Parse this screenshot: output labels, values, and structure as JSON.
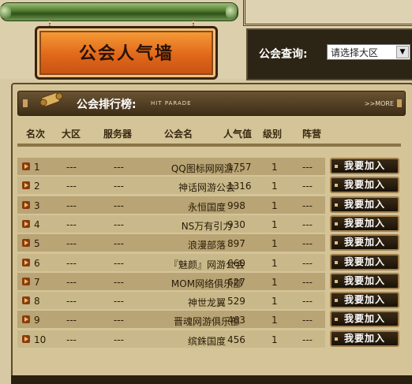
{
  "header": {
    "title": "公会人气墙",
    "search_label": "公会查询:",
    "region_select": "请选择大区"
  },
  "panel": {
    "title": "公会排行榜:",
    "subtitle": "HIT PARADE",
    "more": ">>MORE"
  },
  "columns": [
    "名次",
    "大区",
    "服务器",
    "公会名",
    "人气值",
    "级别",
    "阵营"
  ],
  "join_label": "我要加入",
  "rows": [
    {
      "rank": "1",
      "region": "---",
      "server": "---",
      "guild": "QQ图标网网游...",
      "popularity": "1757",
      "level": "1",
      "camp": "---"
    },
    {
      "rank": "2",
      "region": "---",
      "server": "---",
      "guild": "神话网游公会",
      "popularity": "1316",
      "level": "1",
      "camp": "---"
    },
    {
      "rank": "3",
      "region": "---",
      "server": "---",
      "guild": "永恒国度",
      "popularity": "998",
      "level": "1",
      "camp": "---"
    },
    {
      "rank": "4",
      "region": "---",
      "server": "---",
      "guild": "NS万有引力",
      "popularity": "930",
      "level": "1",
      "camp": "---"
    },
    {
      "rank": "5",
      "region": "---",
      "server": "---",
      "guild": "浪漫部落",
      "popularity": "897",
      "level": "1",
      "camp": "---"
    },
    {
      "rank": "6",
      "region": "---",
      "server": "---",
      "guild": "『魅颜』网游公会",
      "popularity": "660",
      "level": "1",
      "camp": "---"
    },
    {
      "rank": "7",
      "region": "---",
      "server": "---",
      "guild": "MOM网络俱乐部",
      "popularity": "627",
      "level": "1",
      "camp": "---"
    },
    {
      "rank": "8",
      "region": "---",
      "server": "---",
      "guild": "神世龙翼",
      "popularity": "529",
      "level": "1",
      "camp": "---"
    },
    {
      "rank": "9",
      "region": "---",
      "server": "---",
      "guild": "晋魂网游俱乐部",
      "popularity": "463",
      "level": "1",
      "camp": "---"
    },
    {
      "rank": "10",
      "region": "---",
      "server": "---",
      "guild": "缤銖国度",
      "popularity": "456",
      "level": "1",
      "camp": "---"
    }
  ]
}
